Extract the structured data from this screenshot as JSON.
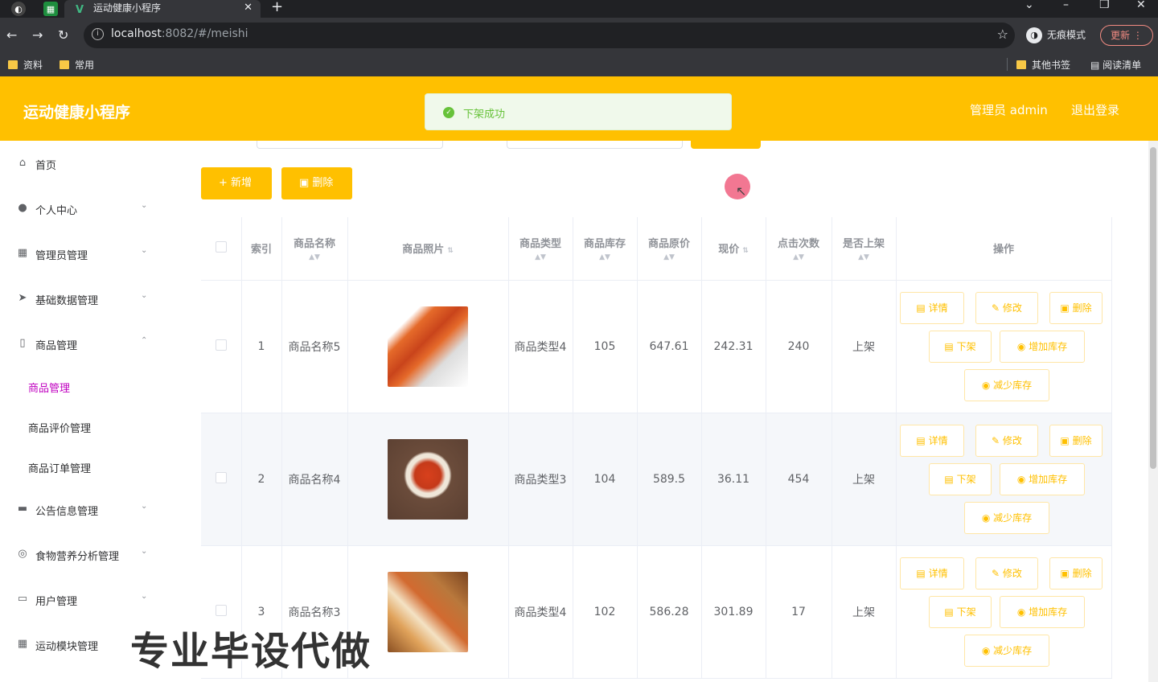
{
  "browser": {
    "tab_title": "运动健康小程序",
    "url_host": "localhost",
    "url_rest": ":8082/#/meishi",
    "incognito_label": "无痕模式",
    "update_label": "更新",
    "bookmarks": [
      "资料",
      "常用"
    ],
    "other_bookmarks": "其他书签",
    "reading_list": "阅读清单"
  },
  "header": {
    "brand": "运动健康小程序",
    "user": "管理员 admin",
    "logout": "退出登录"
  },
  "toast": {
    "message": "下架成功"
  },
  "sidebar": {
    "items": [
      {
        "label": "首页",
        "icon": "home-icon"
      },
      {
        "label": "个人中心",
        "icon": "user-icon"
      },
      {
        "label": "管理员管理",
        "icon": "grid-icon"
      },
      {
        "label": "基础数据管理",
        "icon": "send-icon"
      },
      {
        "label": "商品管理",
        "icon": "phone-icon"
      },
      {
        "label": "公告信息管理",
        "icon": "briefcase-icon"
      },
      {
        "label": "食物营养分析管理",
        "icon": "compass-icon"
      },
      {
        "label": "用户管理",
        "icon": "chat-icon"
      },
      {
        "label": "运动模块管理",
        "icon": "apps-icon"
      }
    ],
    "sub_items": [
      "商品管理",
      "商品评价管理",
      "商品订单管理"
    ]
  },
  "toolbar": {
    "add": "新增",
    "delete": "删除"
  },
  "table": {
    "headers": {
      "index": "索引",
      "name": "商品名称",
      "photo": "商品照片",
      "type": "商品类型",
      "stock": "商品库存",
      "orig_price": "商品原价",
      "price": "现价",
      "clicks": "点击次数",
      "onsale": "是否上架",
      "ops": "操作"
    },
    "rows": [
      {
        "index": "1",
        "name": "商品名称5",
        "type": "商品类型4",
        "stock": "105",
        "orig_price": "647.61",
        "price": "242.31",
        "clicks": "240",
        "onsale": "上架"
      },
      {
        "index": "2",
        "name": "商品名称4",
        "type": "商品类型3",
        "stock": "104",
        "orig_price": "589.5",
        "price": "36.11",
        "clicks": "454",
        "onsale": "上架"
      },
      {
        "index": "3",
        "name": "商品名称3",
        "type": "商品类型4",
        "stock": "102",
        "orig_price": "586.28",
        "price": "301.89",
        "clicks": "17",
        "onsale": "上架"
      }
    ],
    "ops": {
      "detail": "详情",
      "edit": "修改",
      "delete": "删除",
      "offshelf": "下架",
      "add_stock": "增加库存",
      "reduce_stock": "减少库存"
    }
  },
  "watermark": "专业毕设代做",
  "colors": {
    "accent": "#ffc000",
    "success": "#67c23a",
    "active_menu": "#c000c0"
  }
}
